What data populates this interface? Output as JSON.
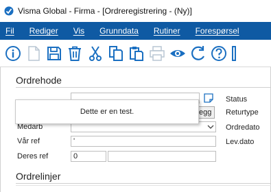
{
  "window": {
    "title": "Visma Global - Firma - [Ordreregistrering - (Ny)]"
  },
  "menu": [
    {
      "label": "Fil"
    },
    {
      "label": "Rediger"
    },
    {
      "label": "Vis"
    },
    {
      "label": "Grunndata"
    },
    {
      "label": "Rutiner"
    },
    {
      "label": "Forespørsel"
    }
  ],
  "toolbar": {
    "icons": [
      "info-icon",
      "new-document-icon",
      "save-icon",
      "delete-icon",
      "cut-icon",
      "copy-icon",
      "paste-icon",
      "print-icon",
      "preview-icon",
      "refresh-icon",
      "help-icon"
    ],
    "accent_color": "#1a6fc1"
  },
  "ordrehode": {
    "title": "Ordrehode",
    "labels": {
      "medarb": "Medarb",
      "var_ref": "Vår ref",
      "deres_ref": "Deres ref"
    },
    "values": {
      "var_ref": "'",
      "deres_ref": "0"
    },
    "button_label": "legg",
    "right_labels": [
      "Status",
      "Returtype",
      "Ordredato",
      "Lev.dato"
    ]
  },
  "tooltip": {
    "text": "Dette er en test."
  },
  "ordrelinjer": {
    "title": "Ordrelinjer"
  },
  "colors": {
    "menubar": "#0f5aa3",
    "menu_text": "#ffffff"
  }
}
